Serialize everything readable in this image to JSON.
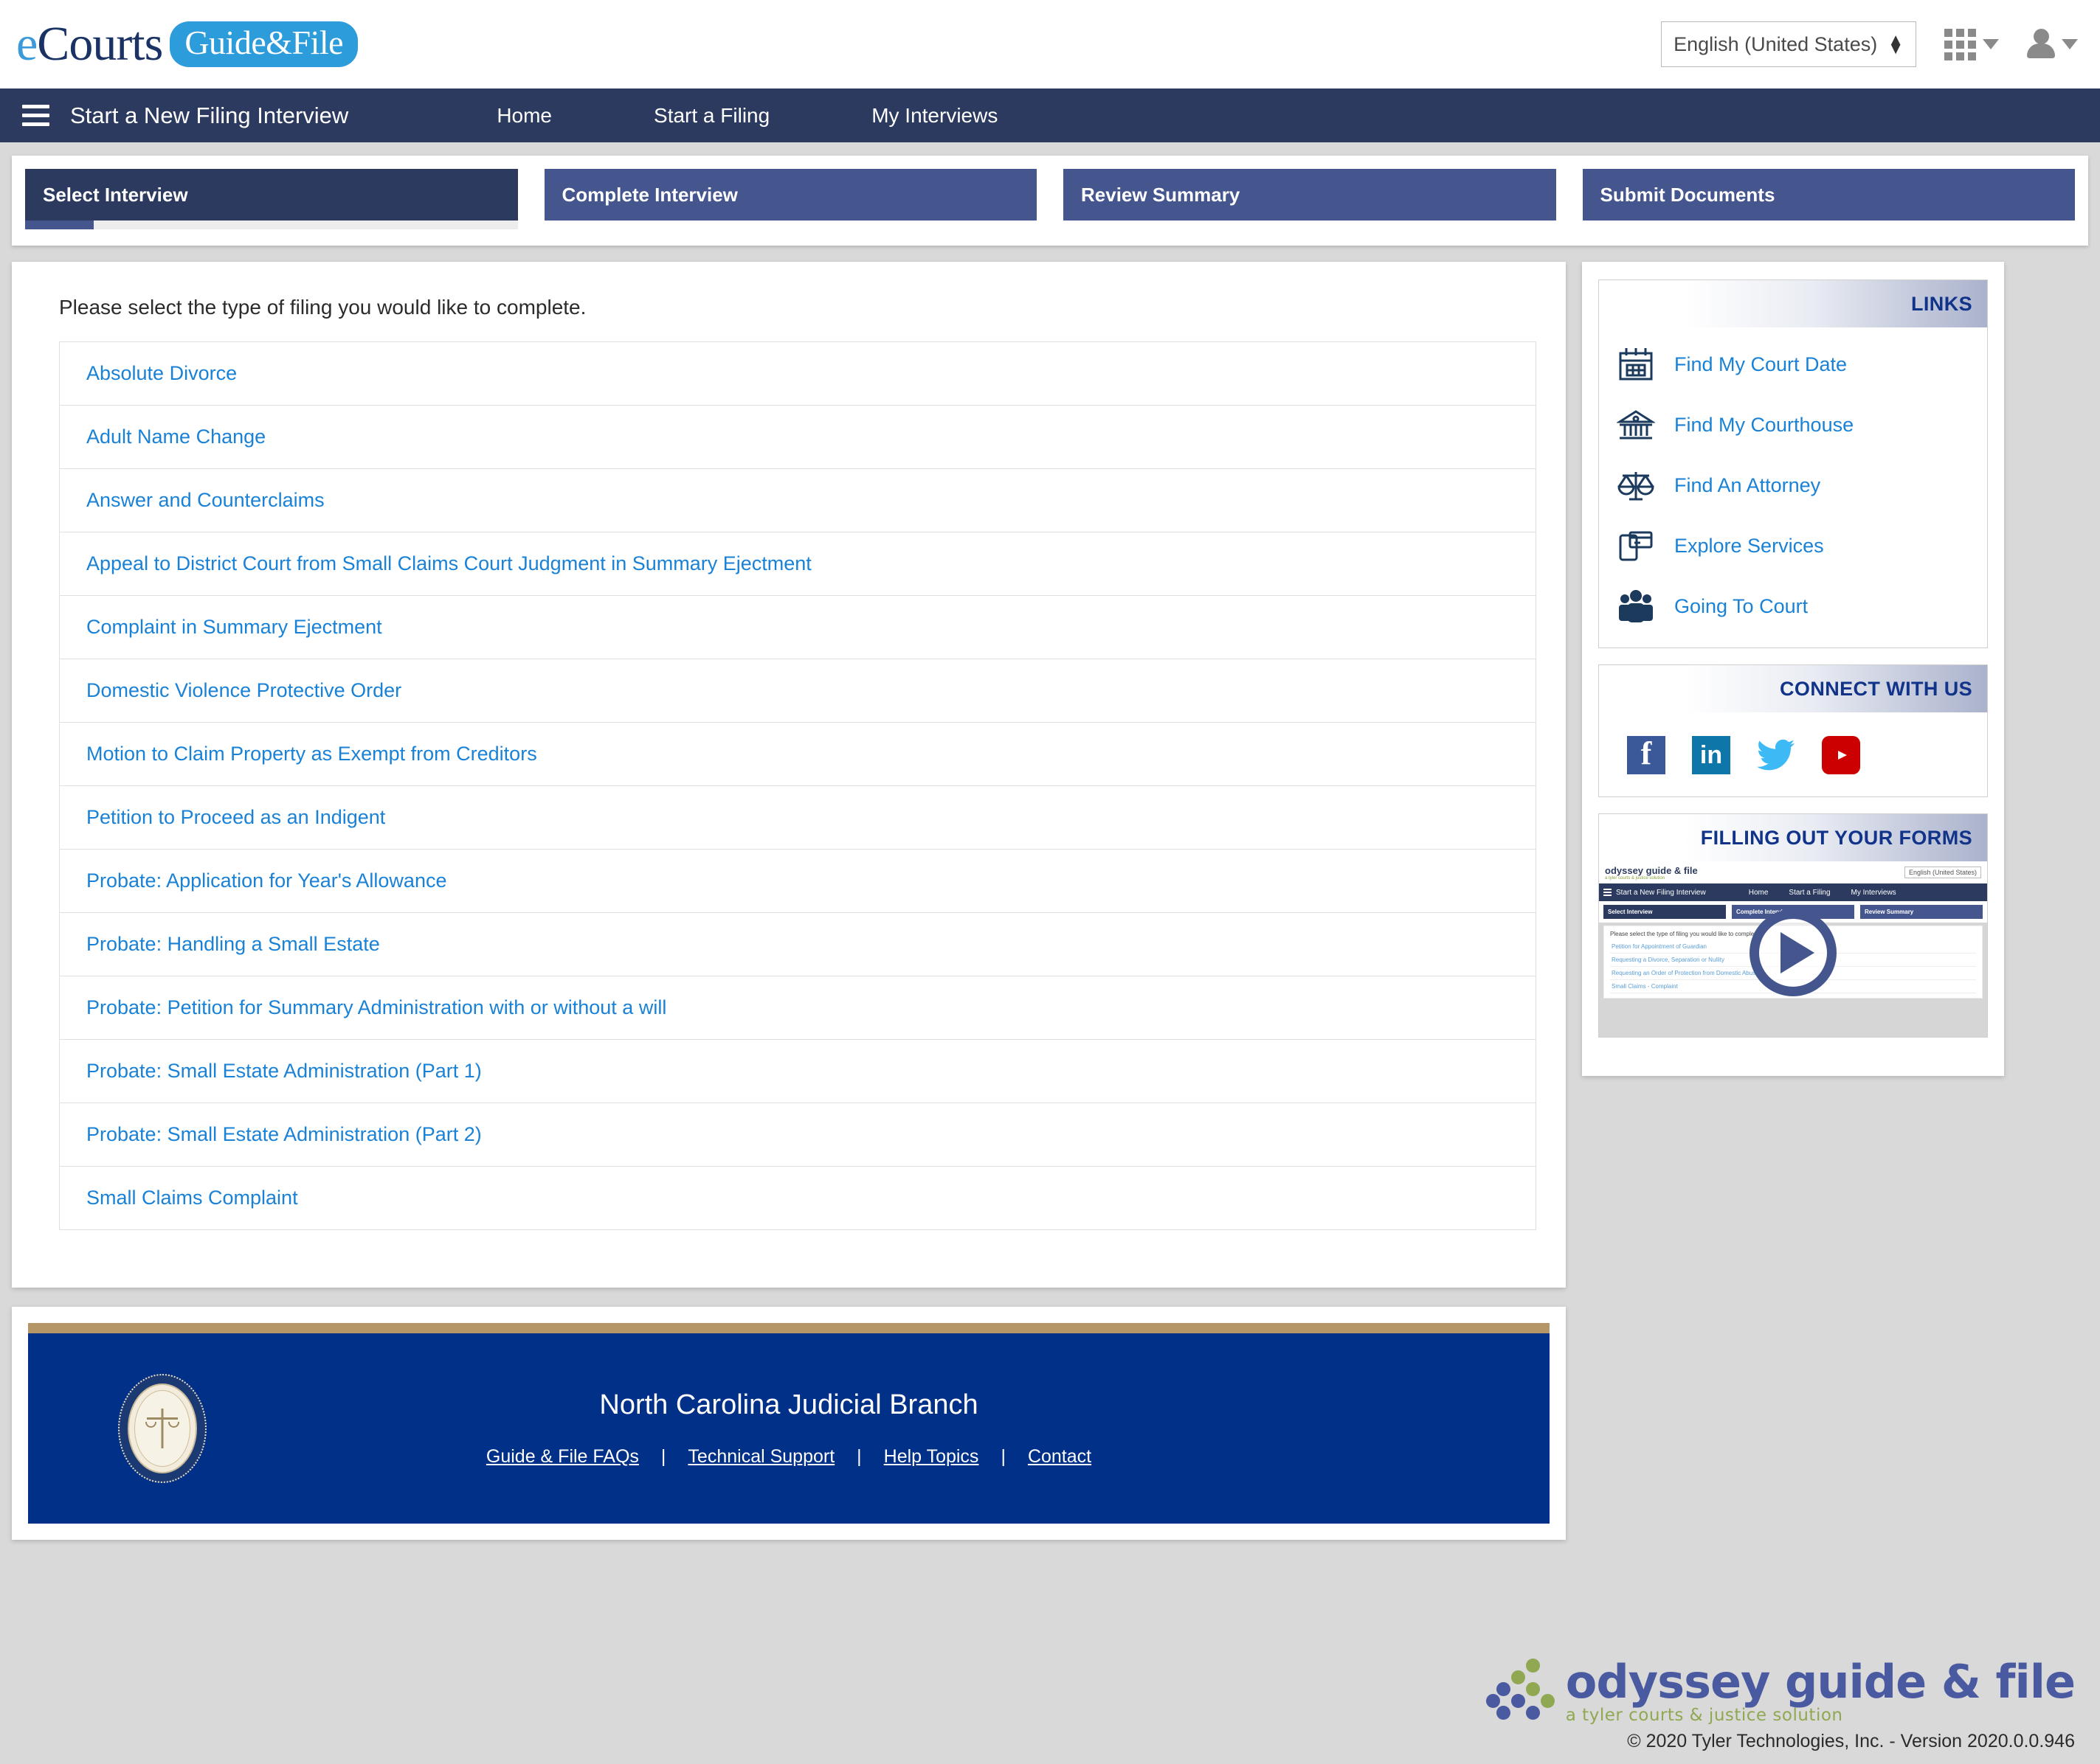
{
  "brand": {
    "logo_e": "e",
    "logo_courts": "Courts",
    "logo_pill": "Guide&File",
    "language_value": "English (United States)",
    "apps_icon": "grid-apps-icon",
    "user_icon": "user-account-icon"
  },
  "nav": {
    "menu_icon": "hamburger-menu-icon",
    "title": "Start a New Filing Interview",
    "links": [
      {
        "label": "Home"
      },
      {
        "label": "Start a Filing"
      },
      {
        "label": "My Interviews"
      }
    ]
  },
  "steps": [
    {
      "label": "Select Interview",
      "active": true,
      "progress_pct": 14
    },
    {
      "label": "Complete Interview",
      "active": false
    },
    {
      "label": "Review Summary",
      "active": false
    },
    {
      "label": "Submit Documents",
      "active": false
    }
  ],
  "main": {
    "prompt": "Please select the type of filing you would like to complete.",
    "filings": [
      {
        "label": "Absolute Divorce"
      },
      {
        "label": "Adult Name Change"
      },
      {
        "label": "Answer and Counterclaims"
      },
      {
        "label": "Appeal to District Court from Small Claims Court Judgment in Summary Ejectment"
      },
      {
        "label": "Complaint in Summary Ejectment"
      },
      {
        "label": "Domestic Violence Protective Order"
      },
      {
        "label": "Motion to Claim Property as Exempt from Creditors"
      },
      {
        "label": "Petition to Proceed as an Indigent"
      },
      {
        "label": "Probate: Application for Year's Allowance"
      },
      {
        "label": "Probate: Handling a Small Estate"
      },
      {
        "label": "Probate: Petition for Summary Administration with or without a will"
      },
      {
        "label": "Probate: Small Estate Administration (Part 1)"
      },
      {
        "label": "Probate: Small Estate Administration (Part 2)"
      },
      {
        "label": "Small Claims Complaint"
      }
    ]
  },
  "sidebar": {
    "links_panel": {
      "title": "LINKS",
      "items": [
        {
          "label": "Find My Court Date",
          "icon": "calendar-icon"
        },
        {
          "label": "Find My Courthouse",
          "icon": "courthouse-icon"
        },
        {
          "label": "Find An Attorney",
          "icon": "scales-of-justice-icon"
        },
        {
          "label": "Explore Services",
          "icon": "services-card-icon"
        },
        {
          "label": "Going To Court",
          "icon": "people-group-icon"
        }
      ]
    },
    "connect_panel": {
      "title": "CONNECT WITH US",
      "socials": [
        {
          "name": "facebook-icon",
          "glyph": "f",
          "color": "#3b5998"
        },
        {
          "name": "linkedin-icon",
          "glyph": "in",
          "color": "#0e76a8"
        },
        {
          "name": "twitter-icon",
          "glyph": "bird",
          "color": "#3dbaf5"
        },
        {
          "name": "youtube-icon",
          "glyph": "play",
          "color": "#cc0000"
        }
      ]
    },
    "video_panel": {
      "title": "FILLING OUT YOUR FORMS",
      "play_icon": "play-button-icon",
      "thumb": {
        "logo": "odyssey guide & file",
        "logo_sub": "a tyler courts & justice solution",
        "language": "English (United States)",
        "nav_title": "Start a New Filing Interview",
        "nav_links": [
          "Home",
          "Start a Filing",
          "My Interviews"
        ],
        "tabs": [
          "Select Interview",
          "Complete Interview",
          "Review Summary"
        ],
        "prompt": "Please select the type of filing you would like to complete.",
        "items": [
          "Petition for Appointment of Guardian",
          "Requesting a Divorce, Separation or Nullity",
          "Requesting an Order of Protection from Domestic Abuse",
          "Small Claims - Complaint"
        ]
      }
    }
  },
  "footer": {
    "seal_icon": "nc-judicial-seal-icon",
    "title": "North Carolina Judicial Branch",
    "links": [
      {
        "label": "Guide & File FAQs"
      },
      {
        "label": "Technical Support"
      },
      {
        "label": "Help Topics"
      },
      {
        "label": "Contact"
      }
    ],
    "separator": "|"
  },
  "bottom": {
    "logo_text": "odyssey guide & file",
    "logo_sub": "a tyler courts & justice solution",
    "copyright": "© 2020 Tyler Technologies, Inc. - Version 2020.0.0.946"
  }
}
